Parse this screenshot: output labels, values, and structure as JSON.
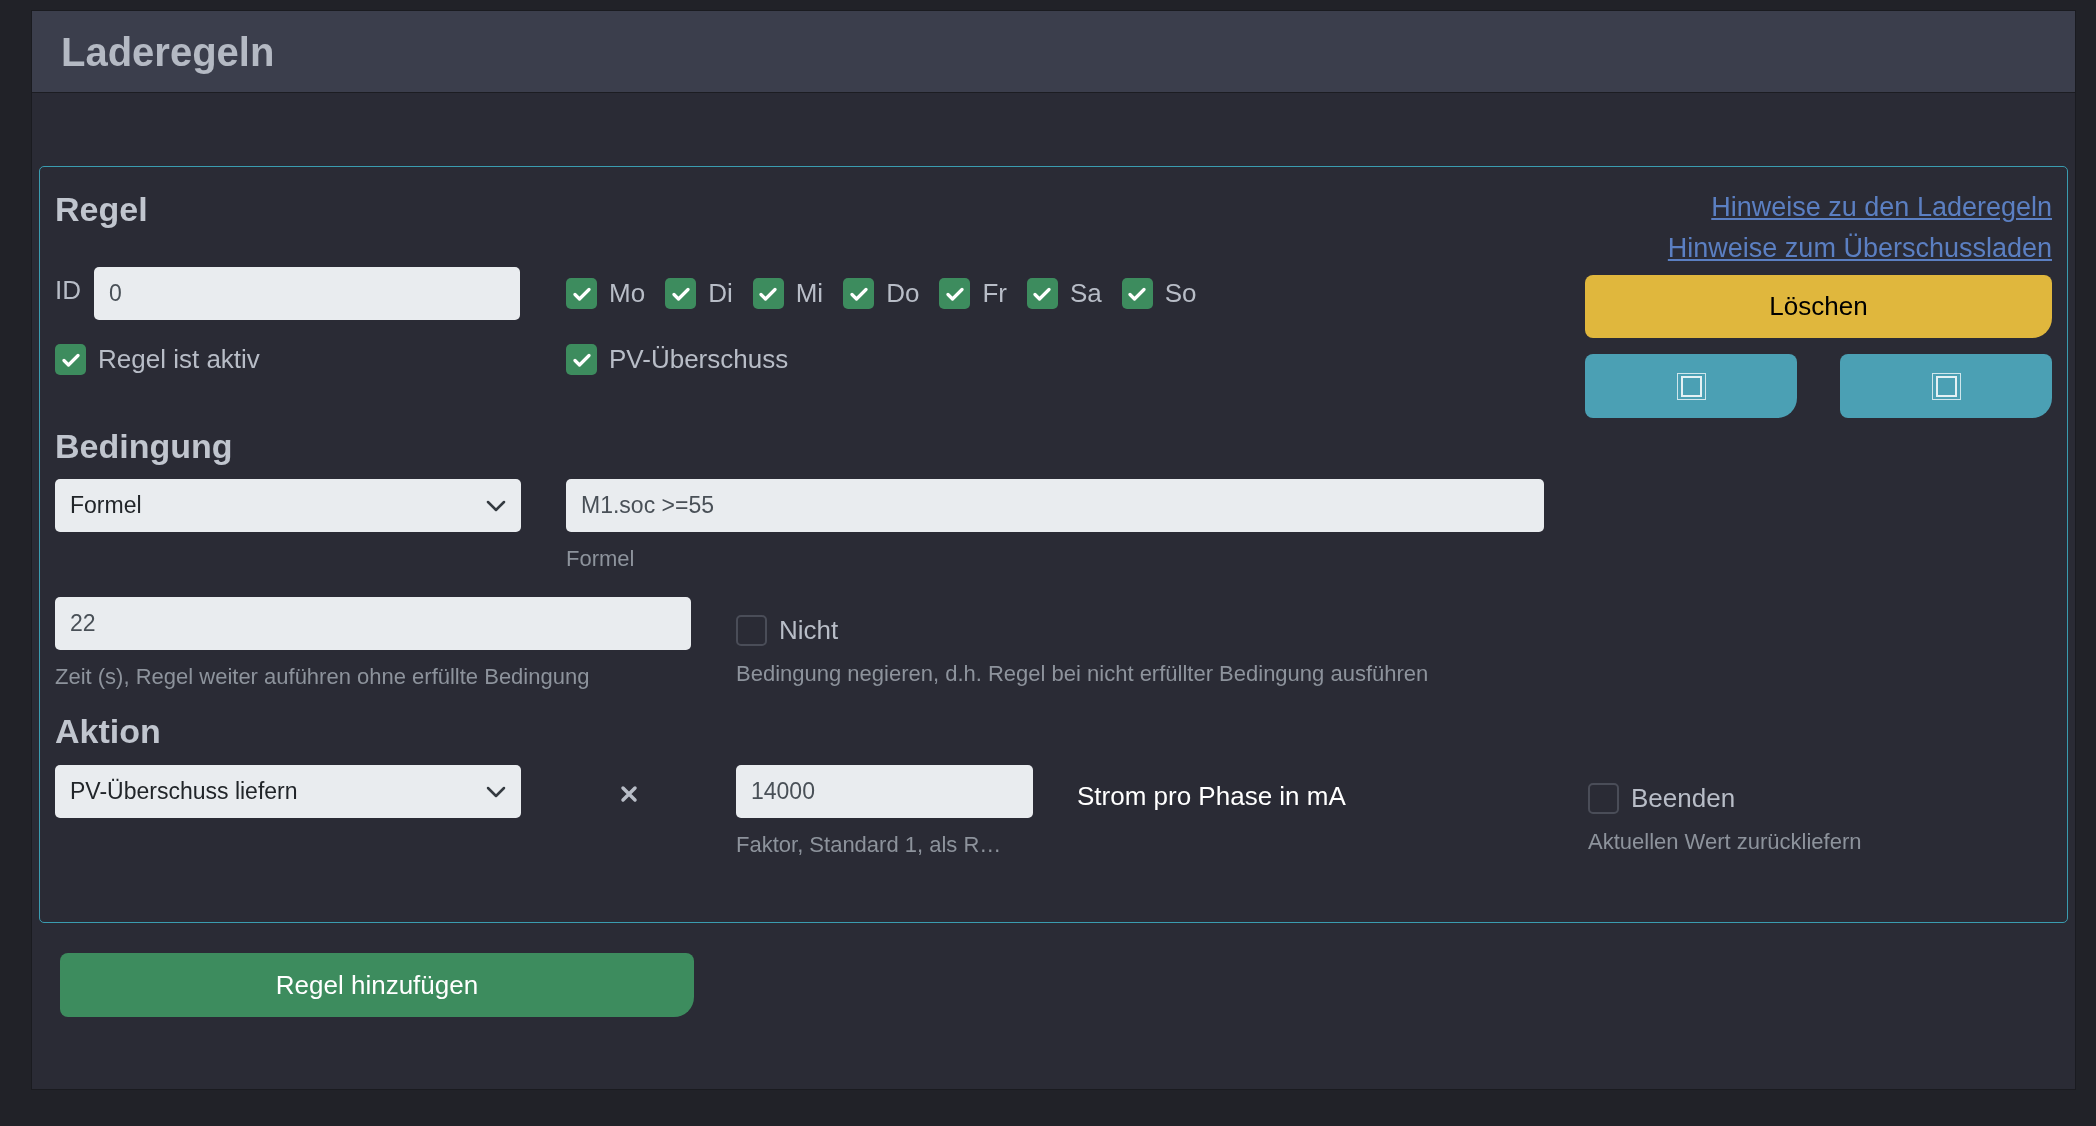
{
  "page_title": "Laderegeln",
  "rule": {
    "heading": "Regel",
    "links": [
      "Hinweise zu den Laderegeln",
      "Hinweise zum Überschussladen"
    ],
    "id": {
      "label": "ID",
      "value": "0"
    },
    "days": [
      {
        "label": "Mo",
        "checked": true
      },
      {
        "label": "Di",
        "checked": true
      },
      {
        "label": "Mi",
        "checked": true
      },
      {
        "label": "Do",
        "checked": true
      },
      {
        "label": "Fr",
        "checked": true
      },
      {
        "label": "Sa",
        "checked": true
      },
      {
        "label": "So",
        "checked": true
      }
    ],
    "active": {
      "label": "Regel ist aktiv",
      "checked": true
    },
    "pv_surplus": {
      "label": "PV-Überschuss",
      "checked": true
    },
    "delete_button": "Löschen",
    "condition": {
      "heading": "Bedingung",
      "type": "Formel",
      "formula": "M1.soc >=55",
      "formula_hint": "Formel",
      "time": "22",
      "time_hint": "Zeit (s), Regel weiter auführen ohne erfüllte Bedingung",
      "negate": {
        "label": "Nicht",
        "checked": false
      },
      "negate_hint": "Bedingung negieren, d.h. Regel bei nicht erfüllter Bedingung ausführen"
    },
    "action": {
      "heading": "Aktion",
      "type": "PV-Überschuss liefern",
      "factor": "14000",
      "factor_hint": "Faktor, Standard 1, als R…",
      "unit": "Strom pro Phase in mA",
      "finish": {
        "label": "Beenden",
        "checked": false
      },
      "finish_hint": "Aktuellen Wert zurückliefern"
    }
  },
  "add_button": "Regel hinzufügen"
}
